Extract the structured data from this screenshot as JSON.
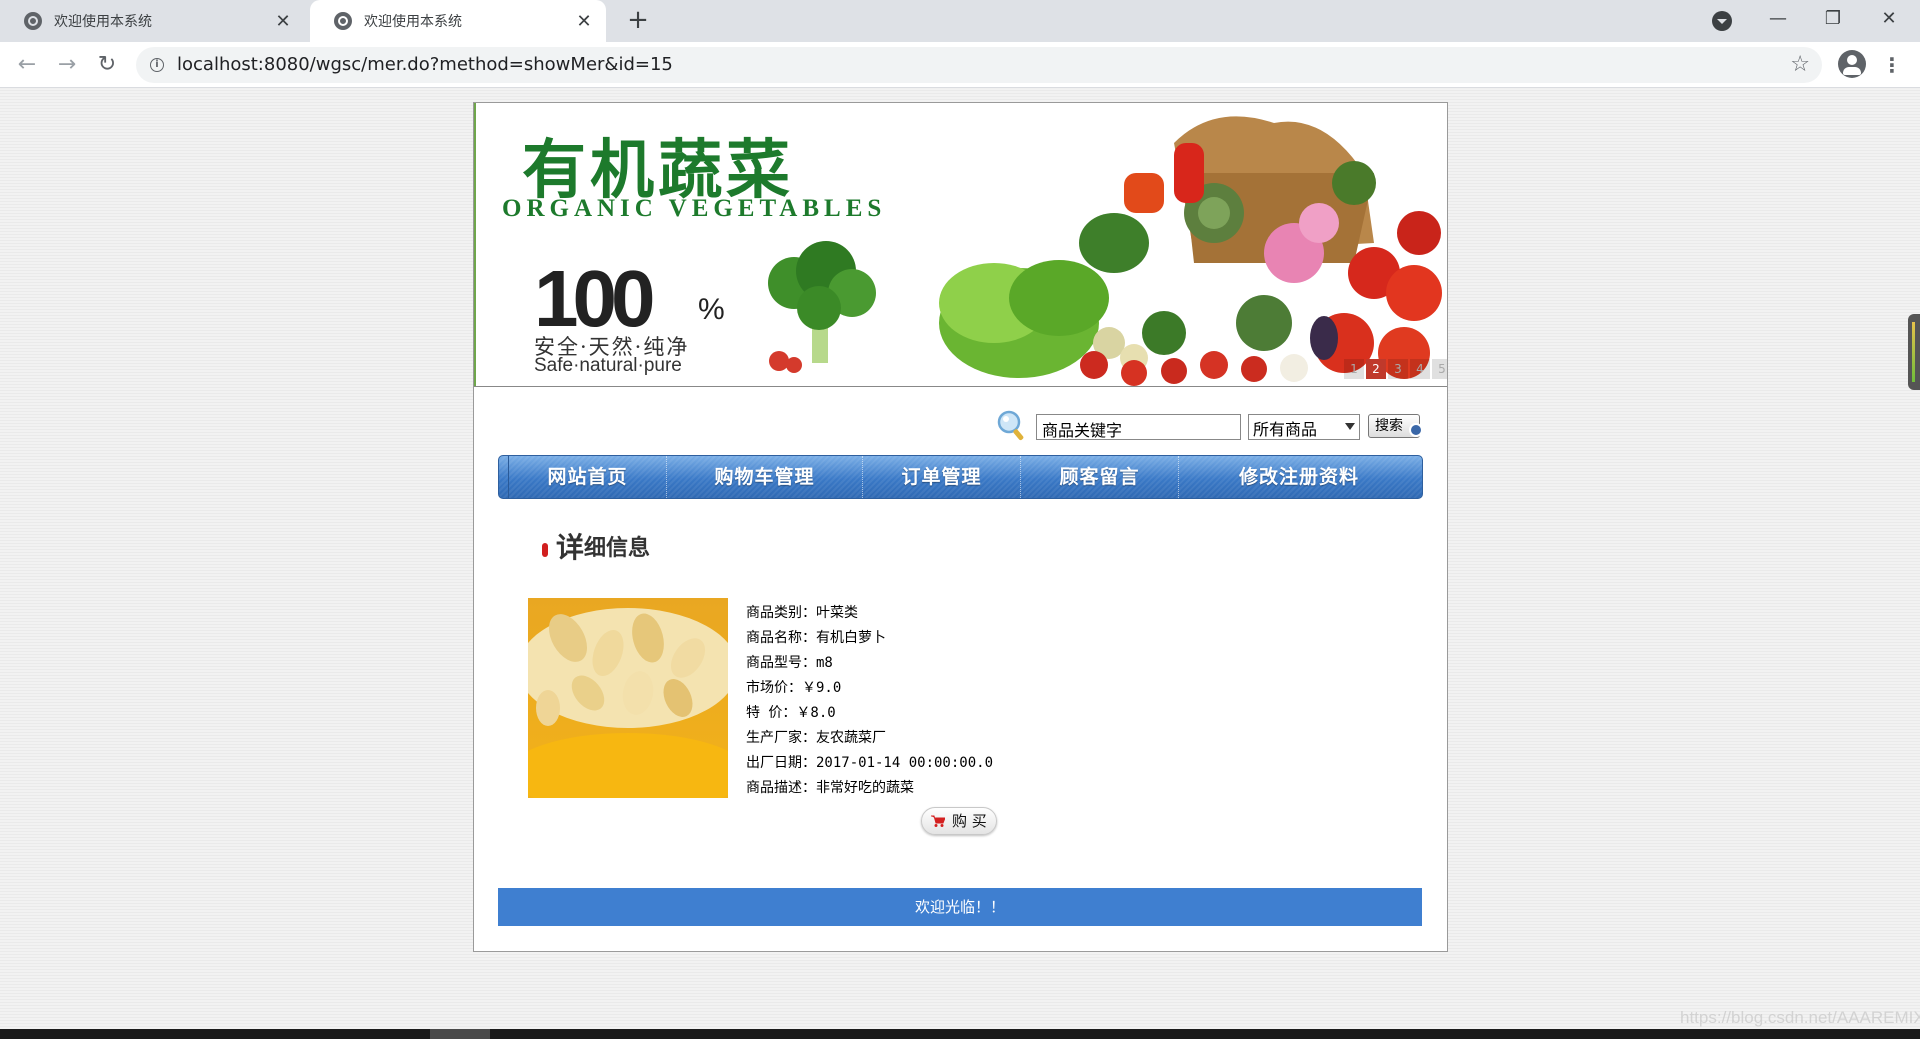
{
  "browser": {
    "tabs": [
      {
        "title": "欢迎使用本系统",
        "close": "✕"
      },
      {
        "title": "欢迎使用本系统",
        "close": "✕"
      }
    ],
    "new_tab": "+",
    "window": {
      "minimize": "—",
      "maximize": "❐",
      "close": "✕"
    },
    "nav": {
      "back": "←",
      "forward": "→",
      "reload": "↻"
    },
    "info": "i",
    "url": "localhost:8080/wgsc/mer.do?method=showMer&id=15",
    "star": "☆",
    "menu": "⋮"
  },
  "banner": {
    "title_cn": "有机蔬菜",
    "title_en": "ORGANIC VEGETABLES",
    "big_number": "100",
    "percent": "%",
    "slogan_cn": "安全·天然·纯净",
    "slogan_en": "Safe·natural·pure",
    "slides": [
      "1",
      "2",
      "3",
      "4",
      "5"
    ],
    "active_slide": 2
  },
  "search": {
    "input_value": "商品关键字",
    "category_selected": "所有商品",
    "button_label": "搜索"
  },
  "nav_items": [
    "网站首页",
    "购物车管理",
    "订单管理",
    "顾客留言",
    "修改注册资料"
  ],
  "detail": {
    "heading_big": "详",
    "heading_rest": "细信息"
  },
  "product": {
    "lines": [
      "商品类别：叶菜类",
      "商品名称：有机白萝卜",
      "商品型号：m8",
      "市场价：￥9.0",
      "特  价：￥8.0",
      "生产厂家：友农蔬菜厂",
      "出厂日期：2017-01-14 00:00:00.0",
      "商品描述：非常好吃的蔬菜"
    ],
    "buy_label": "购 买"
  },
  "footer": {
    "text": "欢迎光临！！"
  },
  "watermark": "https://blog.csdn.net/AAAREMIX",
  "colors": {
    "nav_blue": "#3a79c7",
    "footer_blue": "#3f7fd0",
    "logo_green": "#1d7a2c"
  }
}
